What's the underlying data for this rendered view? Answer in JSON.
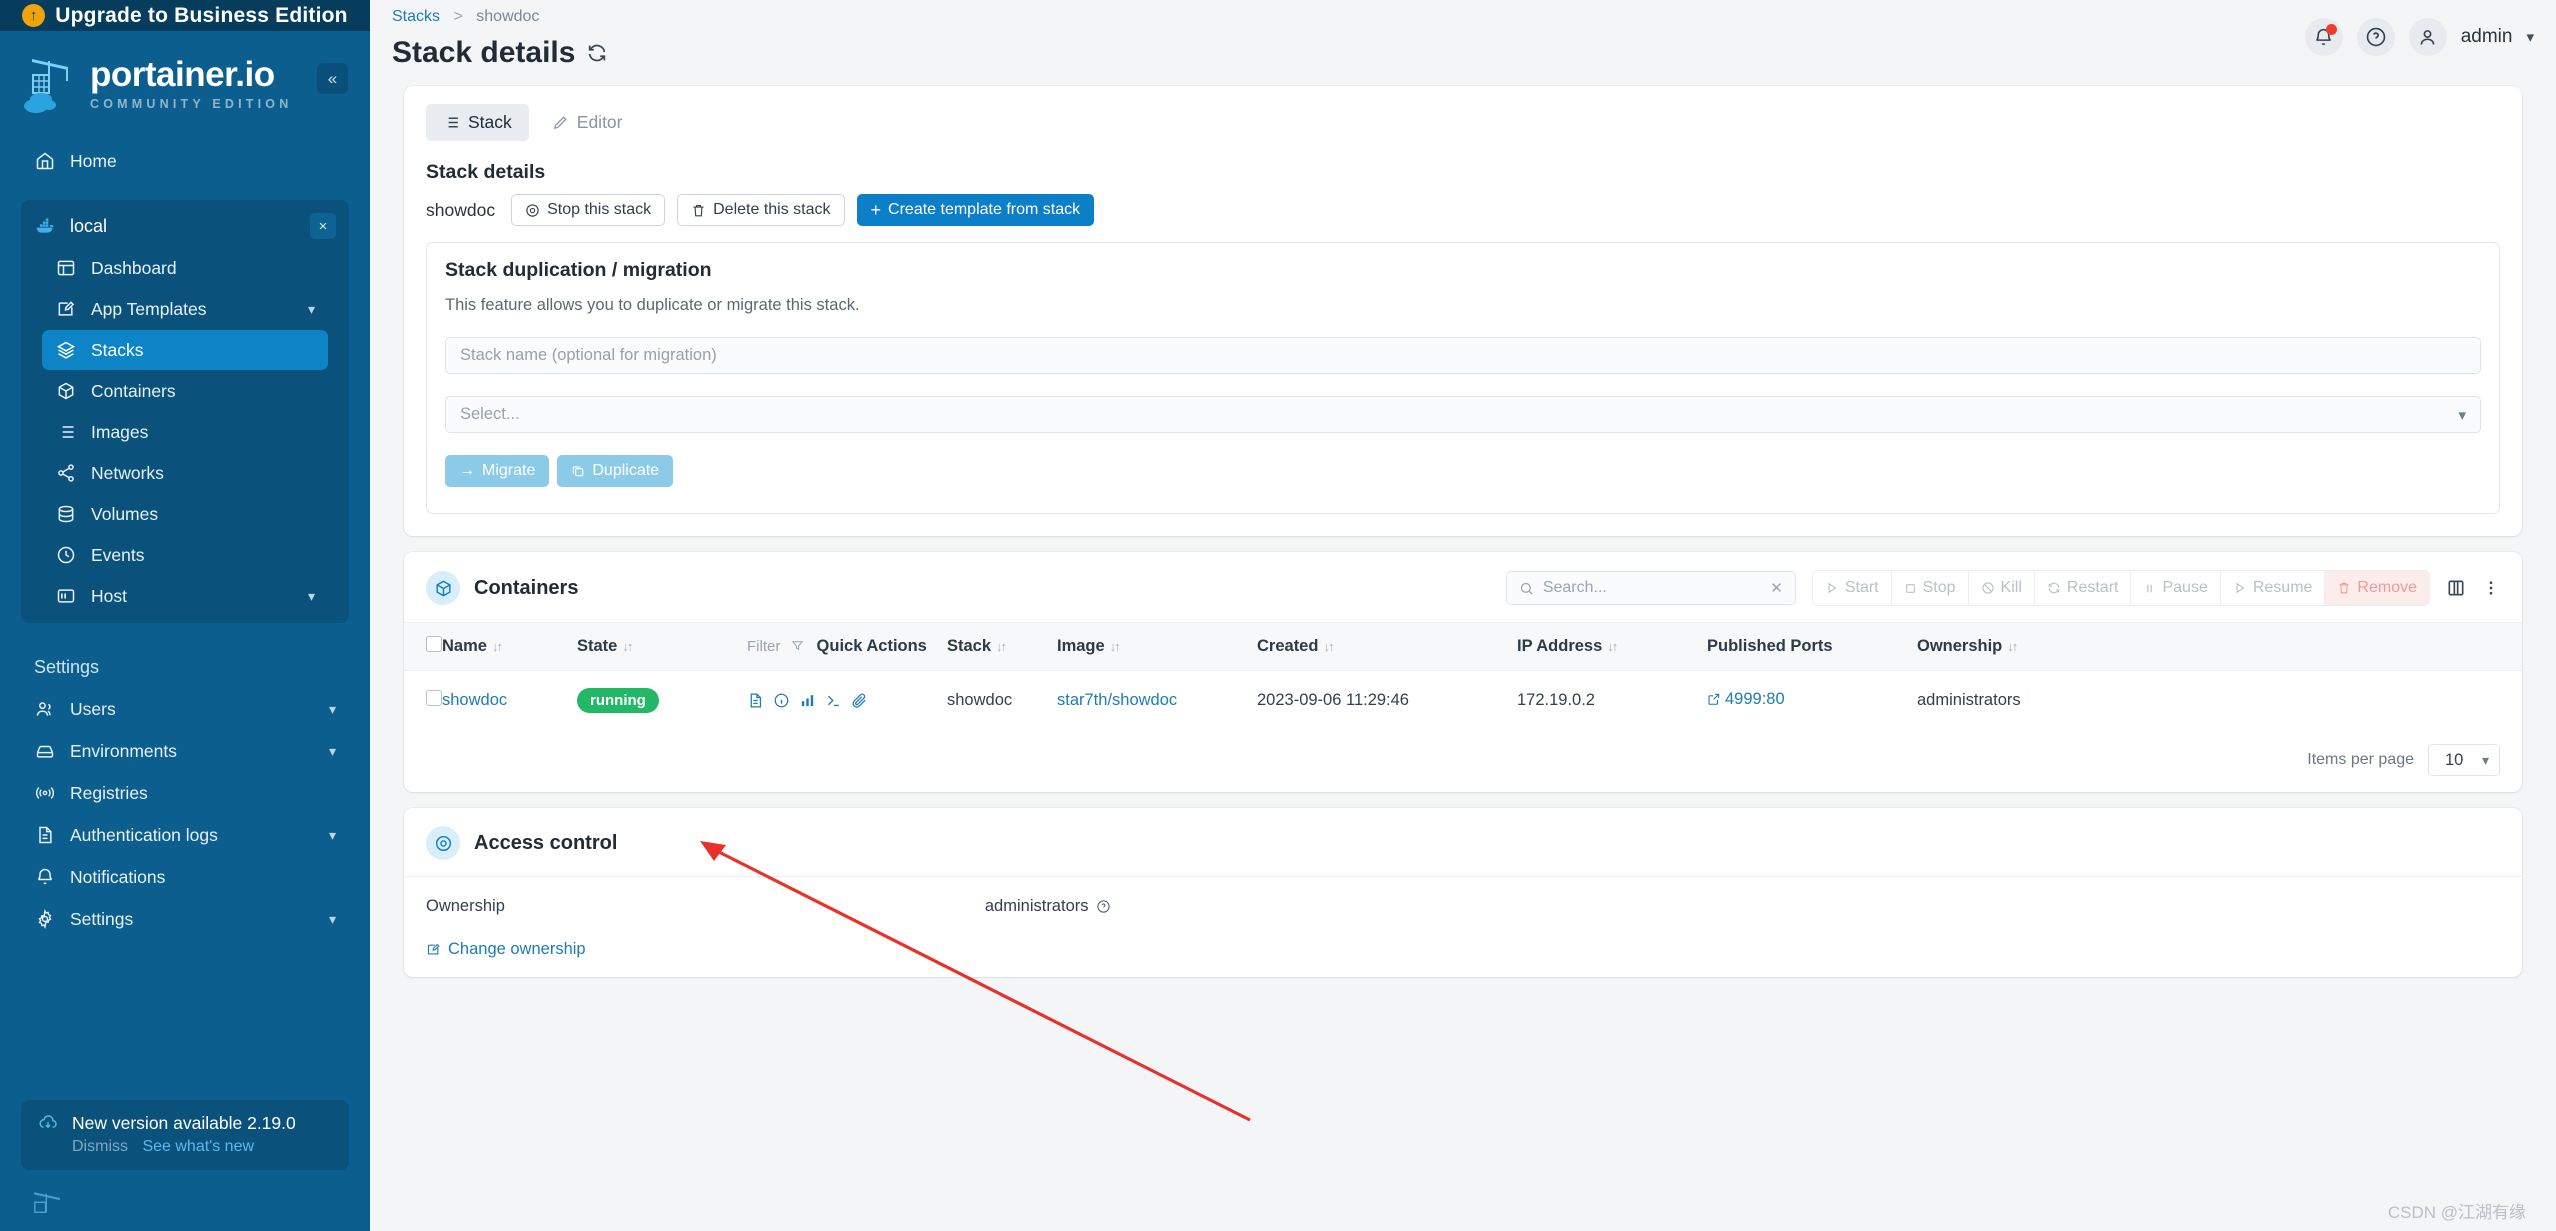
{
  "sidebar": {
    "upgrade_banner": "Upgrade to Business Edition",
    "logo_title": "portainer.io",
    "logo_subtitle": "COMMUNITY EDITION",
    "collapse_label": "«",
    "home_label": "Home",
    "environment": {
      "name": "local",
      "close_label": "×"
    },
    "env_items": [
      {
        "label": "Dashboard",
        "icon": "dashboard-icon",
        "expandable": false
      },
      {
        "label": "App Templates",
        "icon": "app-templates-icon",
        "expandable": true
      },
      {
        "label": "Stacks",
        "icon": "stacks-icon",
        "expandable": false,
        "active": true
      },
      {
        "label": "Containers",
        "icon": "containers-icon",
        "expandable": false
      },
      {
        "label": "Images",
        "icon": "images-icon",
        "expandable": false
      },
      {
        "label": "Networks",
        "icon": "networks-icon",
        "expandable": false
      },
      {
        "label": "Volumes",
        "icon": "volumes-icon",
        "expandable": false
      },
      {
        "label": "Events",
        "icon": "events-icon",
        "expandable": false
      },
      {
        "label": "Host",
        "icon": "host-icon",
        "expandable": true
      }
    ],
    "settings_label": "Settings",
    "settings_items": [
      {
        "label": "Users",
        "icon": "users-icon",
        "expandable": true
      },
      {
        "label": "Environments",
        "icon": "environments-icon",
        "expandable": true
      },
      {
        "label": "Registries",
        "icon": "registries-icon",
        "expandable": false
      },
      {
        "label": "Authentication logs",
        "icon": "auth-logs-icon",
        "expandable": true
      },
      {
        "label": "Notifications",
        "icon": "notifications-icon",
        "expandable": false
      },
      {
        "label": "Settings",
        "icon": "gear-icon",
        "expandable": true
      }
    ],
    "version": {
      "message": "New version available 2.19.0",
      "dismiss": "Dismiss",
      "whats_new": "See what's new"
    }
  },
  "header": {
    "breadcrumb_root": "Stacks",
    "breadcrumb_sep": ">",
    "breadcrumb_current": "showdoc",
    "page_title": "Stack details",
    "user_name": "admin"
  },
  "stack_card": {
    "tabs": [
      {
        "label": "Stack",
        "active": true
      },
      {
        "label": "Editor",
        "active": false
      }
    ],
    "section_title": "Stack details",
    "stack_name": "showdoc",
    "buttons": [
      {
        "label": "Stop this stack",
        "style": "outline"
      },
      {
        "label": "Delete this stack",
        "style": "outline"
      },
      {
        "label": "Create template from stack",
        "style": "primary"
      }
    ],
    "duplication": {
      "title": "Stack duplication / migration",
      "description": "This feature allows you to duplicate or migrate this stack.",
      "name_placeholder": "Stack name (optional for migration)",
      "select_placeholder": "Select...",
      "migrate_label": "Migrate",
      "duplicate_label": "Duplicate"
    }
  },
  "containers": {
    "title": "Containers",
    "search_placeholder": "Search...",
    "search_value": "",
    "actions": [
      {
        "label": "Start",
        "icon": "play-icon"
      },
      {
        "label": "Stop",
        "icon": "stop-icon"
      },
      {
        "label": "Kill",
        "icon": "kill-icon"
      },
      {
        "label": "Restart",
        "icon": "restart-icon"
      },
      {
        "label": "Pause",
        "icon": "pause-icon"
      },
      {
        "label": "Resume",
        "icon": "resume-icon"
      },
      {
        "label": "Remove",
        "icon": "trash-icon",
        "danger": true
      }
    ],
    "columns": [
      "Name",
      "State",
      "Quick Actions",
      "Stack",
      "Image",
      "Created",
      "IP Address",
      "Published Ports",
      "Ownership"
    ],
    "filter_label": "Filter",
    "rows": [
      {
        "name": "showdoc",
        "state": "running",
        "stack": "showdoc",
        "image": "star7th/showdoc",
        "created": "2023-09-06 11:29:46",
        "ip_address": "172.19.0.2",
        "published_ports": "4999:80",
        "ownership": "administrators"
      }
    ],
    "items_per_page_label": "Items per page",
    "items_per_page_value": "10"
  },
  "access_control": {
    "title": "Access control",
    "ownership_label": "Ownership",
    "ownership_value": "administrators",
    "change_ownership_label": "Change ownership"
  },
  "watermark": "CSDN @江湖有缘",
  "colors": {
    "sidebar_bg": "#0b5e8e",
    "sidebar_banner_bg": "#063c5c",
    "accent": "#0b7fc7",
    "active_nav": "#0c84c6",
    "running_badge": "#22b866",
    "danger": "#ef9a9a",
    "annotation_arrow": "#e8312b"
  }
}
